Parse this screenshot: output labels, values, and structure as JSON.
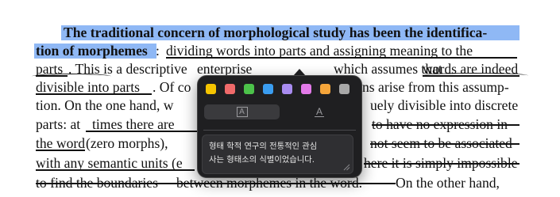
{
  "document": {
    "lines": [
      {
        "text": "The traditional concern of morphological study has been the identifica-"
      },
      {
        "t1": "tion of morphemes",
        "t2": ": ",
        "t3": "dividing words into parts and assigning meaning to the"
      },
      {
        "t1": "parts",
        "t2": ". This is a descriptive ",
        "t3": "enterprise",
        "t4": " which assumes that ",
        "t5": "words are indeed"
      },
      {
        "t1": "divisible into parts",
        "t2": ". Of co",
        "t3": "ns arise from this assump-"
      },
      {
        "t1": "tion. On the one hand, w",
        "t2": "uely divisible into discrete"
      },
      {
        "t1": "parts: at ",
        "t2": "times there are",
        "t3": "to have no expression in"
      },
      {
        "t1": "the word",
        "t2": " (zero morphs), ",
        "t3": "not seem to be associated"
      },
      {
        "t1": "with any semantic units (e",
        "t2": "here it is simply impossible"
      },
      {
        "t1": "to find the boundaries ",
        "t2": "between morphemes in the word.",
        "t3": " On the other hand,"
      }
    ]
  },
  "popup": {
    "colors": [
      {
        "name": "yellow",
        "hex": "#f5c400"
      },
      {
        "name": "red",
        "hex": "#f06a6a"
      },
      {
        "name": "green",
        "hex": "#4cc24a"
      },
      {
        "name": "blue",
        "hex": "#3a9df0"
      },
      {
        "name": "purple",
        "hex": "#a98cf0"
      },
      {
        "name": "pink",
        "hex": "#e27ae8"
      },
      {
        "name": "orange",
        "hex": "#f5a53a"
      },
      {
        "name": "gray",
        "hex": "#a8a8a8"
      }
    ],
    "highlight_style_label": "A",
    "underline_style_label": "A",
    "note_text": "형태 학적 연구의 전통적인 관심\n사는 형태소의 식별이었습니다."
  }
}
